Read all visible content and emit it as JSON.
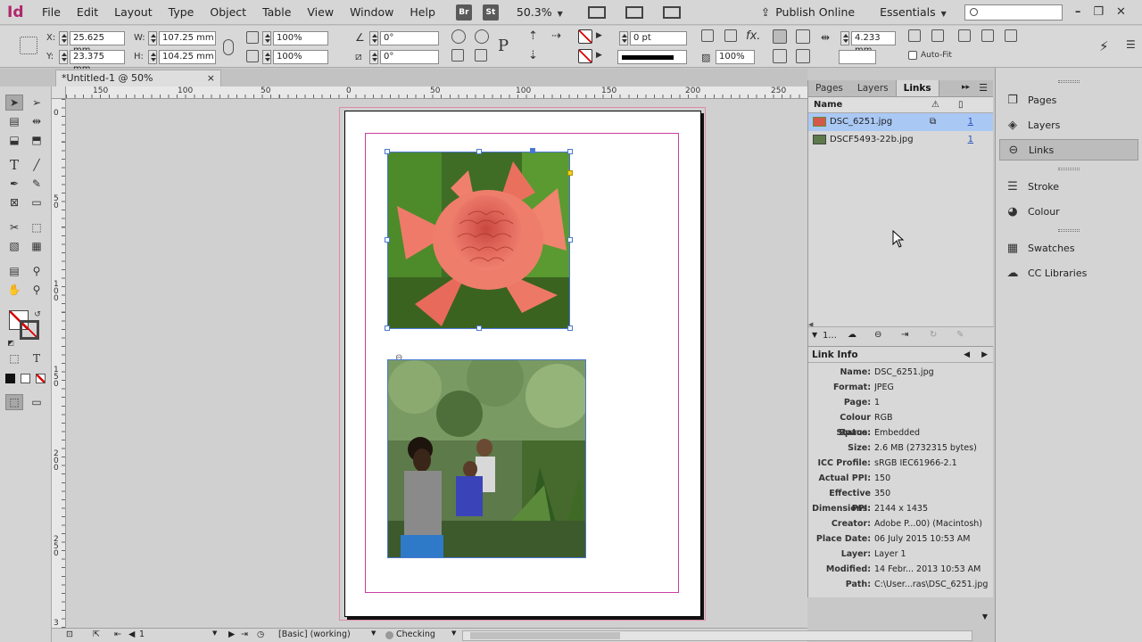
{
  "app": {
    "logo": "Id"
  },
  "menu": [
    "File",
    "Edit",
    "Layout",
    "Type",
    "Object",
    "Table",
    "View",
    "Window",
    "Help"
  ],
  "menubar": {
    "bridge": "Br",
    "stock": "St",
    "zoom": "50.3%",
    "publish": "Publish Online",
    "workspace": "Essentials",
    "search_placeholder": ""
  },
  "control": {
    "x_label": "X:",
    "x_value": "25.625 mm",
    "y_label": "Y:",
    "y_value": "23.375 mm",
    "w_label": "W:",
    "w_value": "107.25 mm",
    "h_label": "H:",
    "h_value": "104.25 mm",
    "scale_x": "100%",
    "scale_y": "100%",
    "rotate": "0°",
    "shear": "0°",
    "stroke_weight": "0 pt",
    "opacity": "100%",
    "gap": "4.233 mm",
    "autofit": "Auto-Fit"
  },
  "document_tab": {
    "title": "*Untitled-1 @ 50%",
    "close": "×"
  },
  "ruler_h": [
    "150",
    "100",
    "50",
    "0",
    "50",
    "100",
    "150",
    "200",
    "250"
  ],
  "ruler_v": [
    "0",
    "5\n0",
    "1\n0\n0",
    "1\n5\n0",
    "2\n0\n0",
    "2\n5\n0",
    "3"
  ],
  "links_panel": {
    "tabs": [
      "Pages",
      "Layers",
      "Links"
    ],
    "active_tab": "Links",
    "column_name": "Name",
    "links": [
      {
        "name": "DSC_6251.jpg",
        "page": "1",
        "selected": true
      },
      {
        "name": "DSCF5493-22b.jpg",
        "page": "1",
        "selected": false
      }
    ],
    "footer_count": "1..."
  },
  "link_info": {
    "title": "Link Info",
    "rows": [
      {
        "k": "Name:",
        "v": "DSC_6251.jpg"
      },
      {
        "k": "Format:",
        "v": "JPEG"
      },
      {
        "k": "Page:",
        "v": "1"
      },
      {
        "k": "Colour Space:",
        "v": "RGB"
      },
      {
        "k": "Status:",
        "v": "Embedded"
      },
      {
        "k": "Size:",
        "v": "2.6 MB (2732315 bytes)"
      },
      {
        "k": "ICC Profile:",
        "v": "sRGB IEC61966-2.1"
      },
      {
        "k": "Actual PPI:",
        "v": "150"
      },
      {
        "k": "Effective PPI:",
        "v": "350"
      },
      {
        "k": "Dimensions:",
        "v": "2144 x 1435"
      },
      {
        "k": "Creator:",
        "v": "Adobe P...00)  (Macintosh)"
      },
      {
        "k": "Place Date:",
        "v": "06 July 2015 10:53 AM"
      },
      {
        "k": "Layer:",
        "v": "Layer 1"
      },
      {
        "k": "Modified:",
        "v": "14 Febr... 2013 10:53 AM"
      },
      {
        "k": "Path:",
        "v": "C:\\User...ras\\DSC_6251.jpg"
      }
    ]
  },
  "dock": [
    {
      "label": "Pages",
      "icon": "pages-icon"
    },
    {
      "label": "Layers",
      "icon": "layers-icon"
    },
    {
      "label": "Links",
      "icon": "links-icon",
      "active": true
    },
    {
      "label": "Stroke",
      "icon": "stroke-icon"
    },
    {
      "label": "Colour",
      "icon": "colour-icon"
    },
    {
      "label": "Swatches",
      "icon": "swatches-icon"
    },
    {
      "label": "CC Libraries",
      "icon": "cc-libraries-icon"
    }
  ],
  "status": {
    "page": "1",
    "style": "[Basic] (working)",
    "preflight": "Checking"
  },
  "colors": {
    "accent": "#b0266b",
    "selection": "#4a78d0",
    "margin": "#c83fa0",
    "bleed": "#e08ca6"
  }
}
